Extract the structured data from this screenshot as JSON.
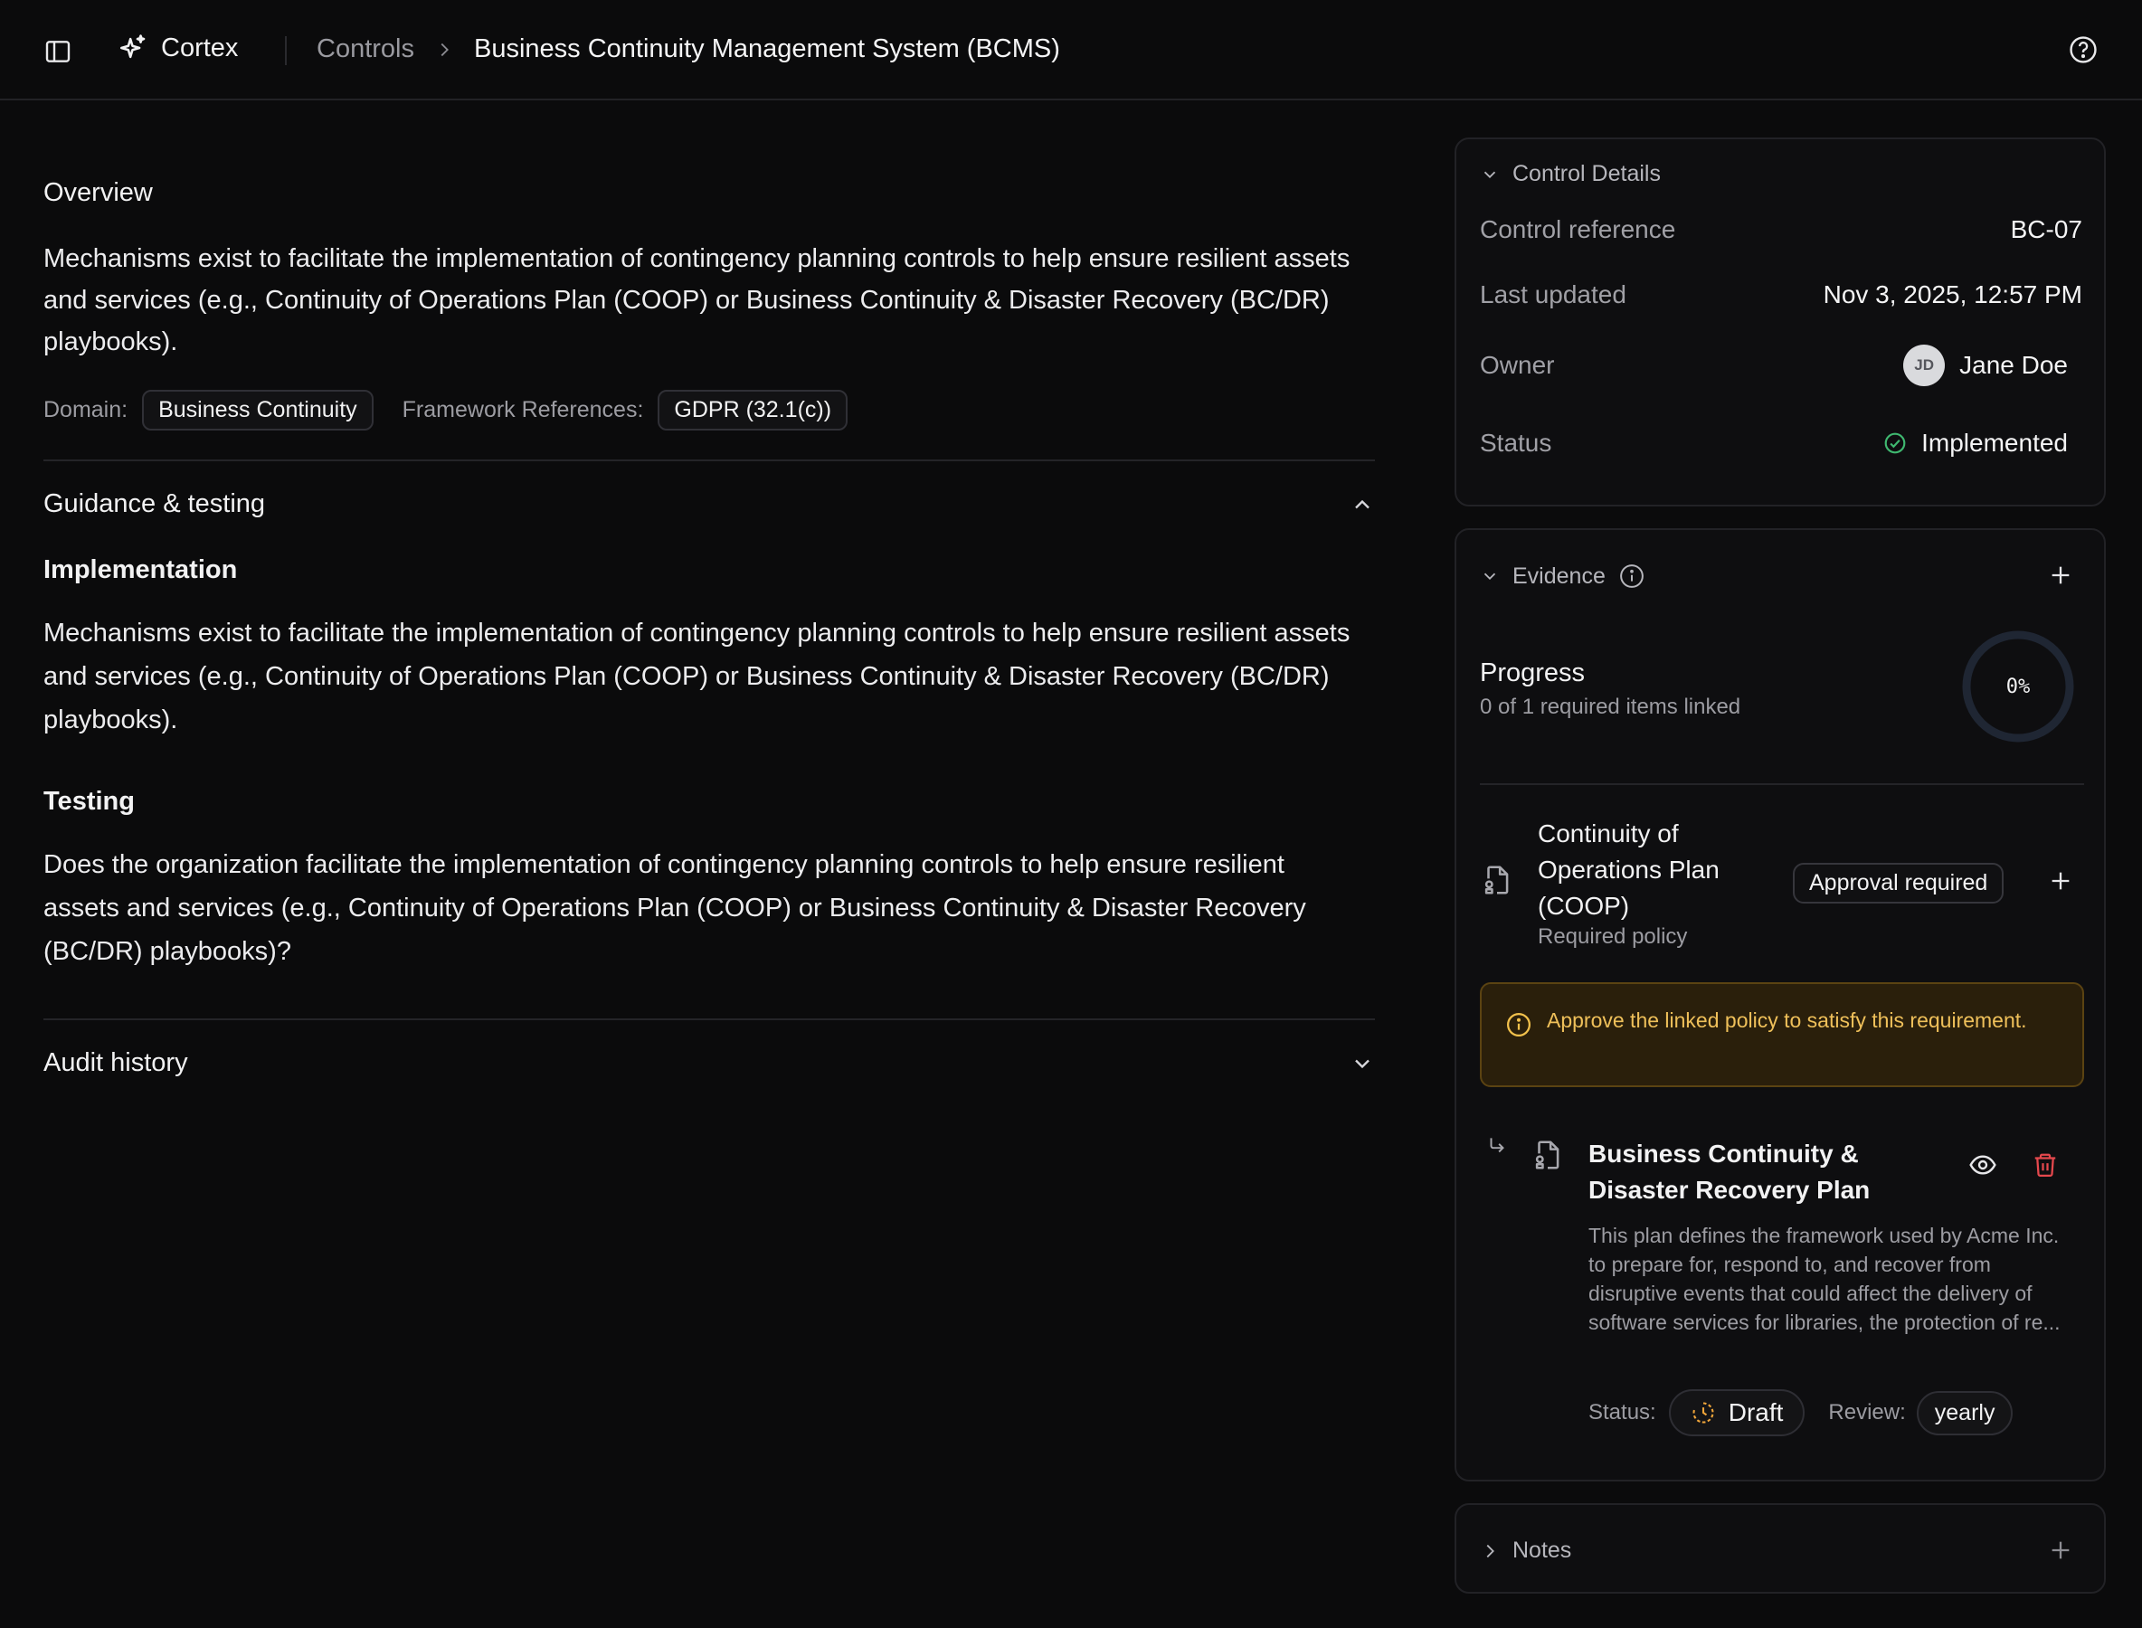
{
  "app": {
    "name": "Cortex"
  },
  "breadcrumb": {
    "parent": "Controls",
    "current": "Business Continuity Management System (BCMS)"
  },
  "overview": {
    "title": "Overview",
    "text": "Mechanisms exist to facilitate the implementation of contingency planning controls to help ensure resilient assets and services (e.g., Continuity of Operations Plan (COOP) or Business Continuity & Disaster Recovery (BC/DR) playbooks).",
    "domain_label": "Domain:",
    "domain_value": "Business Continuity",
    "framework_label": "Framework References:",
    "framework_value": "GDPR (32.1(c))"
  },
  "guidance": {
    "title": "Guidance & testing",
    "implementation_title": "Implementation",
    "implementation_text": "Mechanisms exist to facilitate the implementation of contingency planning controls to help ensure resilient assets and services (e.g., Continuity of Operations Plan (COOP) or Business Continuity & Disaster Recovery (BC/DR) playbooks).",
    "testing_title": "Testing",
    "testing_text": "Does the organization facilitate the implementation of contingency planning controls to help ensure resilient assets and services (e.g., Continuity of Operations Plan (COOP) or Business Continuity & Disaster Recovery (BC/DR) playbooks)?"
  },
  "audit": {
    "title": "Audit history"
  },
  "control_details": {
    "title": "Control Details",
    "reference_label": "Control reference",
    "reference_value": "BC-07",
    "updated_label": "Last updated",
    "updated_value": "Nov 3, 2025, 12:57 PM",
    "owner_label": "Owner",
    "owner_initials": "JD",
    "owner_name": "Jane Doe",
    "status_label": "Status",
    "status_value": "Implemented",
    "status_color": "#3fb870"
  },
  "evidence": {
    "title": "Evidence",
    "progress_title": "Progress",
    "progress_subtitle": "0 of 1 required items linked",
    "progress_percent": "0%",
    "progress_fraction": 0,
    "requirement_title": "Continuity of Operations Plan (COOP)",
    "requirement_subtitle": "Required policy",
    "requirement_badge": "Approval required",
    "warning_text": "Approve the linked policy to satisfy this requirement.",
    "linked": {
      "title": "Business Continuity & Disaster Recovery Plan",
      "description": "This plan defines the framework used by Acme Inc. to prepare for, respond to, and recover from disruptive events that could affect the delivery of software services for libraries, the protection of re...",
      "status_label": "Status:",
      "status_value": "Draft",
      "review_label": "Review:",
      "review_value": "yearly"
    }
  },
  "notes": {
    "title": "Notes"
  },
  "colors": {
    "background": "#0b0b0c",
    "warning": "#efc05a",
    "danger": "#e5484d",
    "draft": "#f0a53a"
  }
}
